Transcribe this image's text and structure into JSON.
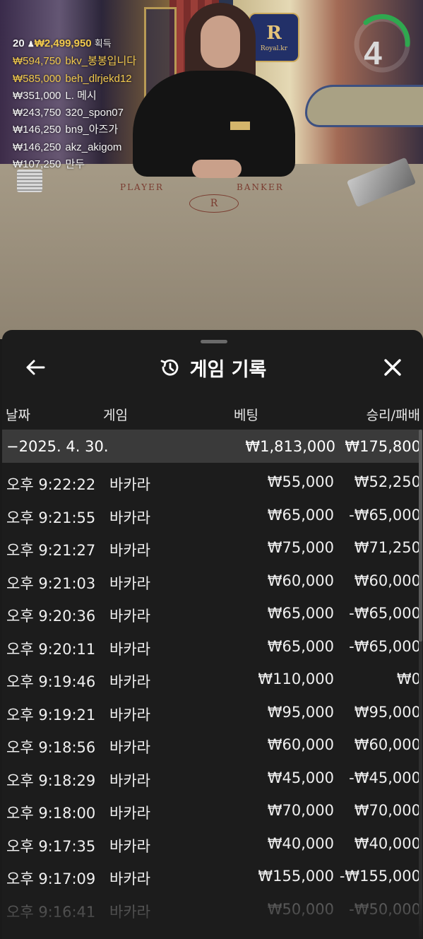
{
  "stream": {
    "round_timer": "4",
    "table_labels": {
      "player": "PLAYER",
      "banker": "BANKER",
      "logo_letter": "R",
      "logo_sub": "Royal.kr"
    },
    "winners_header": {
      "count": "20",
      "amount": "₩2,499,950",
      "suffix": "획득"
    },
    "winners": [
      {
        "amount": "₩594,750",
        "nick": "bkv_봉봉입니다",
        "highlight": true
      },
      {
        "amount": "₩585,000",
        "nick": "beh_dlrjekd12",
        "highlight": true
      },
      {
        "amount": "₩351,000",
        "nick": "L. 메시",
        "highlight": false
      },
      {
        "amount": "₩243,750",
        "nick": "320_spon07",
        "highlight": false
      },
      {
        "amount": "₩146,250",
        "nick": "bn9_아즈가",
        "highlight": false
      },
      {
        "amount": "₩146,250",
        "nick": "akz_akigom",
        "highlight": false
      },
      {
        "amount": "₩107,250",
        "nick": "만두",
        "highlight": false
      }
    ]
  },
  "history": {
    "title": "게임 기록",
    "columns": {
      "date": "날짜",
      "game": "게임",
      "bet": "베팅",
      "win": "승리/패배"
    },
    "group": {
      "date": "−2025. 4. 30.",
      "bet": "₩1,813,000",
      "win": "₩175,800"
    },
    "rows": [
      {
        "time": "오후 9:22:22",
        "game": "바카라",
        "bet": "₩55,000",
        "win": "₩52,250"
      },
      {
        "time": "오후 9:21:55",
        "game": "바카라",
        "bet": "₩65,000",
        "win": "-₩65,000"
      },
      {
        "time": "오후 9:21:27",
        "game": "바카라",
        "bet": "₩75,000",
        "win": "₩71,250"
      },
      {
        "time": "오후 9:21:03",
        "game": "바카라",
        "bet": "₩60,000",
        "win": "₩60,000"
      },
      {
        "time": "오후 9:20:36",
        "game": "바카라",
        "bet": "₩65,000",
        "win": "-₩65,000"
      },
      {
        "time": "오후 9:20:11",
        "game": "바카라",
        "bet": "₩65,000",
        "win": "-₩65,000"
      },
      {
        "time": "오후 9:19:46",
        "game": "바카라",
        "bet": "₩110,000",
        "win": "₩0"
      },
      {
        "time": "오후 9:19:21",
        "game": "바카라",
        "bet": "₩95,000",
        "win": "₩95,000"
      },
      {
        "time": "오후 9:18:56",
        "game": "바카라",
        "bet": "₩60,000",
        "win": "₩60,000"
      },
      {
        "time": "오후 9:18:29",
        "game": "바카라",
        "bet": "₩45,000",
        "win": "-₩45,000"
      },
      {
        "time": "오후 9:18:00",
        "game": "바카라",
        "bet": "₩70,000",
        "win": "₩70,000"
      },
      {
        "time": "오후 9:17:35",
        "game": "바카라",
        "bet": "₩40,000",
        "win": "₩40,000"
      },
      {
        "time": "오후 9:17:09",
        "game": "바카라",
        "bet": "₩155,000",
        "win": "-₩155,000"
      },
      {
        "time": "오후 9:16:41",
        "game": "바카라",
        "bet": "₩50,000",
        "win": "-₩50,000"
      }
    ]
  },
  "colors": {
    "sheet_bg": "#1c1c1c",
    "group_bg": "#3a3a3a",
    "gold": "#f1c94d",
    "timer_green": "#2fa84f"
  },
  "icons": {
    "back": "arrow-left-icon",
    "history": "history-icon",
    "close": "close-icon"
  }
}
